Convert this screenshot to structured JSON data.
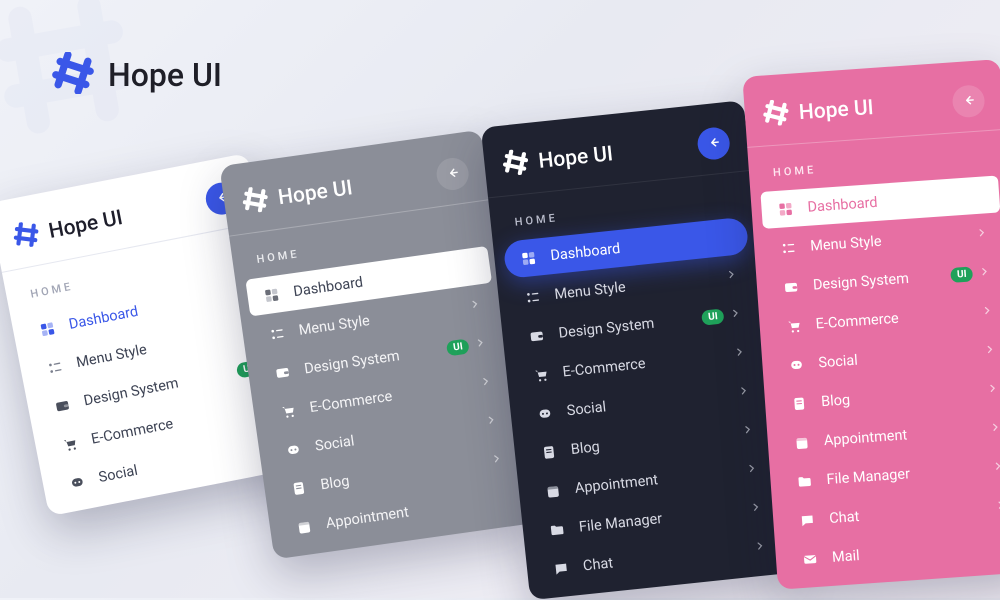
{
  "header": {
    "title": "Hope UI"
  },
  "panels": {
    "light": {
      "brand": "Hope UI",
      "section_label": "HOME",
      "items": [
        {
          "label": "Dashboard"
        },
        {
          "label": "Menu Style"
        },
        {
          "label": "Design System",
          "badge": "UI"
        },
        {
          "label": "E-Commerce"
        },
        {
          "label": "Social"
        }
      ]
    },
    "gray": {
      "brand": "Hope UI",
      "section_label": "HOME",
      "items": [
        {
          "label": "Dashboard"
        },
        {
          "label": "Menu Style"
        },
        {
          "label": "Design System",
          "badge": "UI"
        },
        {
          "label": "E-Commerce"
        },
        {
          "label": "Social"
        },
        {
          "label": "Blog"
        },
        {
          "label": "Appointment"
        }
      ]
    },
    "dark": {
      "brand": "Hope UI",
      "section_label": "HOME",
      "items": [
        {
          "label": "Dashboard"
        },
        {
          "label": "Menu Style"
        },
        {
          "label": "Design System",
          "badge": "UI"
        },
        {
          "label": "E-Commerce"
        },
        {
          "label": "Social"
        },
        {
          "label": "Blog"
        },
        {
          "label": "Appointment"
        },
        {
          "label": "File Manager"
        },
        {
          "label": "Chat"
        }
      ]
    },
    "pink": {
      "brand": "Hope UI",
      "section_label": "HOME",
      "items": [
        {
          "label": "Dashboard"
        },
        {
          "label": "Menu Style"
        },
        {
          "label": "Design System",
          "badge": "UI"
        },
        {
          "label": "E-Commerce"
        },
        {
          "label": "Social"
        },
        {
          "label": "Blog"
        },
        {
          "label": "Appointment"
        },
        {
          "label": "File Manager"
        },
        {
          "label": "Chat"
        },
        {
          "label": "Mail"
        }
      ]
    }
  }
}
